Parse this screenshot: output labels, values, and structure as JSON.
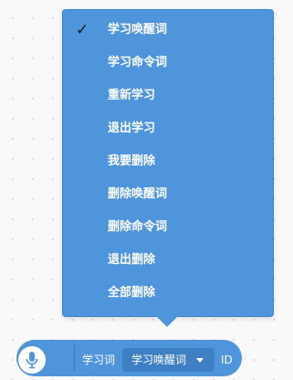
{
  "menu": {
    "items": [
      {
        "label": "学习唤醒词",
        "checked": true
      },
      {
        "label": "学习命令词",
        "checked": false
      },
      {
        "label": "重新学习",
        "checked": false
      },
      {
        "label": "退出学习",
        "checked": false
      },
      {
        "label": "我要删除",
        "checked": false
      },
      {
        "label": "删除唤醒词",
        "checked": false
      },
      {
        "label": "删除命令词",
        "checked": false
      },
      {
        "label": "退出删除",
        "checked": false
      },
      {
        "label": "全部删除",
        "checked": false
      }
    ],
    "check_mark": "✓"
  },
  "block": {
    "icon": "microphone-icon",
    "label": "学习词",
    "selected_value": "学习唤醒词",
    "suffix": "ID"
  },
  "colors": {
    "accent": "#4f95dc",
    "accent_dark": "#3f7fc4",
    "text": "#ffffff"
  }
}
